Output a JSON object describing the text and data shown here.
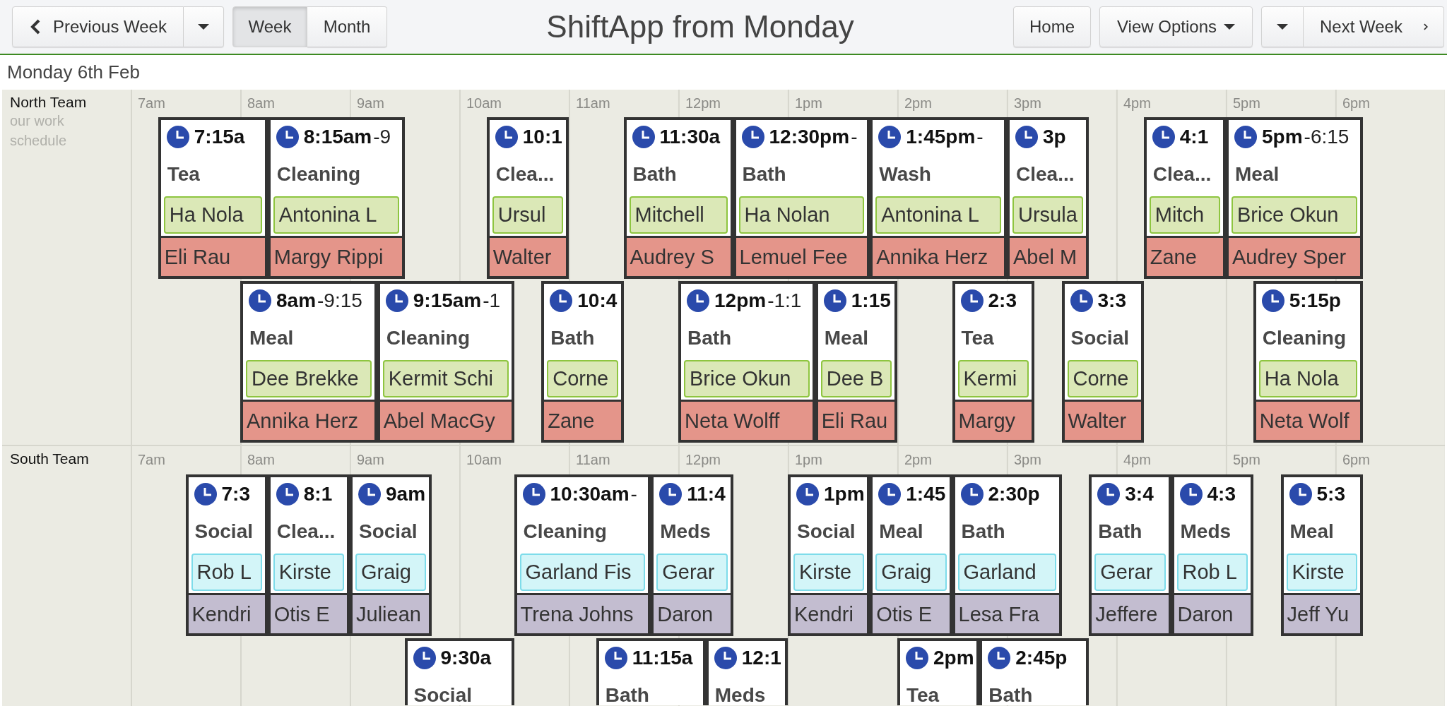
{
  "toolbar": {
    "previous": "Previous Week",
    "view_tabs": [
      {
        "label": "Week",
        "selected": true
      },
      {
        "label": "Month",
        "selected": false
      }
    ],
    "title": "ShiftApp from Monday",
    "home": "Home",
    "view_options": "View Options",
    "next": "Next Week"
  },
  "day": {
    "heading": "Monday 6th Feb"
  },
  "teams": [
    {
      "name": "North Team",
      "subtitle": "our work schedule",
      "hours": [
        "7am",
        "8am",
        "9am",
        "10am",
        "11am",
        "12pm",
        "1pm",
        "2pm",
        "3pm",
        "4pm",
        "5pm",
        "6pm"
      ],
      "lanes": [
        [
          {
            "start": "7:15a",
            "task": "Tea",
            "tag": "Ha Nola",
            "bar": "Eli Rau"
          },
          {
            "start": "8:15am",
            "end": "-9",
            "task": "Cleaning",
            "tag": "Antonina L",
            "bar": "Margy Rippi"
          },
          {
            "start": "10:1",
            "task": "Clea...",
            "tag": "Ursul",
            "bar": "Walter"
          },
          {
            "start": "11:30a",
            "task": "Bath",
            "tag": "Mitchell",
            "bar": "Audrey S"
          },
          {
            "start": "12:30pm",
            "end": "-",
            "task": "Bath",
            "tag": "Ha Nolan",
            "bar": "Lemuel Fee"
          },
          {
            "start": "1:45pm",
            "end": "-",
            "task": "Wash",
            "tag": "Antonina L",
            "bar": "Annika Herz"
          },
          {
            "start": "3p",
            "task": "Clea...",
            "tag": "Ursula",
            "bar": "Abel M"
          },
          {
            "start": "4:1",
            "task": "Clea...",
            "tag": "Mitch",
            "bar": "Zane"
          },
          {
            "start": "5pm",
            "end": "-6:15",
            "task": "Meal",
            "tag": "Brice Okun",
            "bar": "Audrey Sper"
          }
        ],
        [
          {
            "start": "8am",
            "end": "-9:15",
            "task": "Meal",
            "tag": "Dee Brekke",
            "bar": "Annika Herz"
          },
          {
            "start": "9:15am",
            "end": "-1",
            "task": "Cleaning",
            "tag": "Kermit Schi",
            "bar": "Abel MacGy"
          },
          {
            "start": "10:4",
            "task": "Bath",
            "tag": "Corne",
            "bar": "Zane"
          },
          {
            "start": "12pm",
            "end": "-1:1",
            "task": "Bath",
            "tag": "Brice Okun",
            "bar": "Neta Wolff"
          },
          {
            "start": "1:15",
            "task": "Meal",
            "tag": "Dee B",
            "bar": "Eli Rau"
          },
          {
            "start": "2:3",
            "task": "Tea",
            "tag": "Kermi",
            "bar": "Margy"
          },
          {
            "start": "3:3",
            "task": "Social",
            "tag": "Corne",
            "bar": "Walter"
          },
          {
            "start": "5:15p",
            "task": "Cleaning",
            "tag": "Ha Nola",
            "bar": "Neta Wolf"
          }
        ]
      ]
    },
    {
      "name": "South Team",
      "hours": [
        "7am",
        "8am",
        "9am",
        "10am",
        "11am",
        "12pm",
        "1pm",
        "2pm",
        "3pm",
        "4pm",
        "5pm",
        "6pm"
      ],
      "lanes": [
        [
          {
            "start": "7:3",
            "task": "Social",
            "tag": "Rob L",
            "bar": "Kendri"
          },
          {
            "start": "8:1",
            "task": "Clea...",
            "tag": "Kirste",
            "bar": "Otis E"
          },
          {
            "start": "9am",
            "task": "Social",
            "tag": "Graig",
            "bar": "Juliean"
          },
          {
            "start": "10:30am",
            "end": "-",
            "task": "Cleaning",
            "tag": "Garland Fis",
            "bar": "Trena Johns"
          },
          {
            "start": "11:4",
            "task": "Meds",
            "tag": "Gerar",
            "bar": "Daron"
          },
          {
            "start": "1pm",
            "task": "Social",
            "tag": "Kirste",
            "bar": "Kendri"
          },
          {
            "start": "1:45",
            "task": "Meal",
            "tag": "Graig",
            "bar": "Otis E"
          },
          {
            "start": "2:30p",
            "task": "Bath",
            "tag": "Garland",
            "bar": "Lesa Fra"
          },
          {
            "start": "3:4",
            "task": "Bath",
            "tag": "Gerar",
            "bar": "Jeffere"
          },
          {
            "start": "4:3",
            "task": "Meds",
            "tag": "Rob L",
            "bar": "Daron"
          },
          {
            "start": "5:3",
            "task": "Meal",
            "tag": "Kirste",
            "bar": "Jeff Yu"
          }
        ],
        [
          {
            "start": "9:30a",
            "task": "Social"
          },
          {
            "start": "11:15a",
            "task": "Bath"
          },
          {
            "start": "12:1",
            "task": "Meds"
          },
          {
            "start": "2pm",
            "task": "Tea"
          },
          {
            "start": "2:45p",
            "task": "Bath"
          }
        ]
      ]
    }
  ]
}
